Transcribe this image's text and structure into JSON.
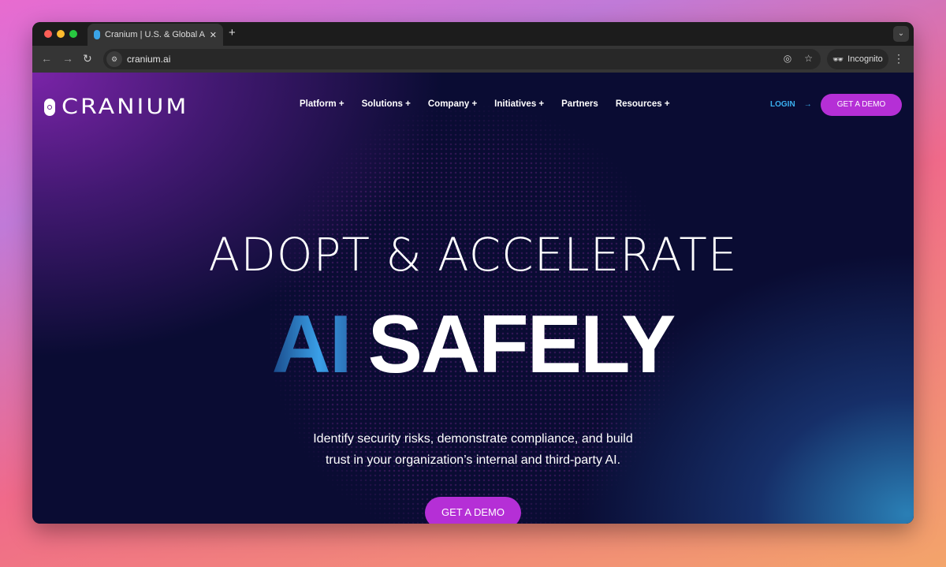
{
  "browser": {
    "tab_title": "Cranium | U.S. & Global AI Go",
    "url": "cranium.ai",
    "profile": "Incognito"
  },
  "site": {
    "logo": "CRANIUM",
    "nav": [
      "Platform +",
      "Solutions +",
      "Company +",
      "Initiatives +",
      "Partners",
      "Resources +"
    ],
    "login": "LOGIN",
    "login_arrow": "→",
    "demo": "GET A DEMO"
  },
  "hero": {
    "line1": "ADOPT & ACCELERATE",
    "ai": "AI",
    "safely": "SAFELY",
    "sub1": "Identify security risks, demonstrate compliance, and build",
    "sub2": "trust in your organization’s internal and third-party AI.",
    "cta": "GET A DEMO"
  },
  "colors": {
    "accent": "#b52fd6",
    "login": "#3ab0f0",
    "background": "#0a0c33"
  }
}
